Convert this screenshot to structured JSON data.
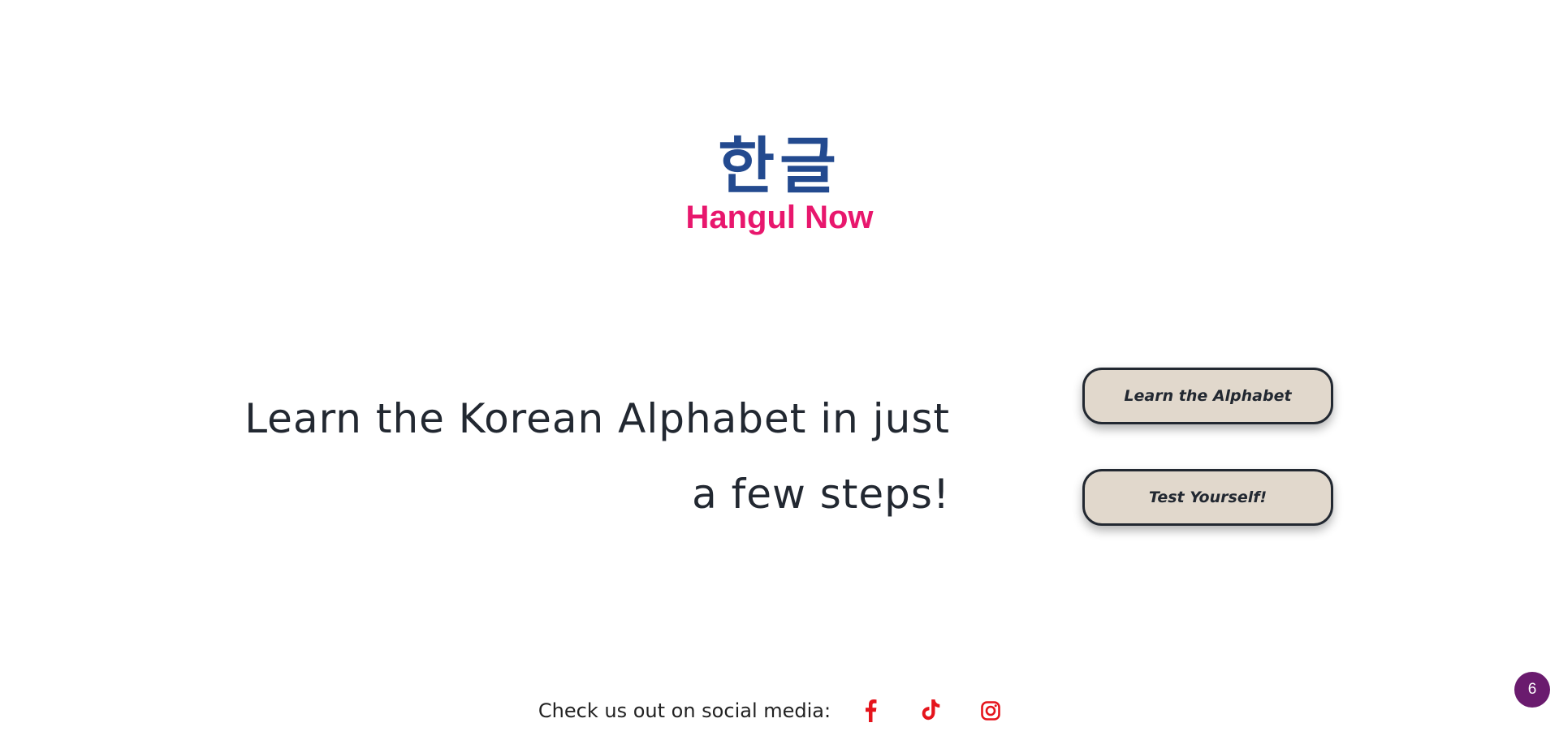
{
  "logo": {
    "korean_text": "한글",
    "name": "Hangul Now"
  },
  "hero": {
    "tagline": "Learn the Korean Alphabet in just a few steps!"
  },
  "buttons": {
    "learn_label": "Learn the Alphabet",
    "test_label": "Test Yourself!"
  },
  "footer": {
    "social_label": "Check us out on social media:",
    "icons": [
      "facebook-icon",
      "tiktok-icon",
      "instagram-icon"
    ]
  },
  "badge": {
    "count": "6"
  },
  "colors": {
    "brand_blue": "#234a8f",
    "brand_pink": "#e8176d",
    "button_bg": "#e1d8cc",
    "social_red": "#e5141c",
    "badge_purple": "#6a1b6e"
  }
}
